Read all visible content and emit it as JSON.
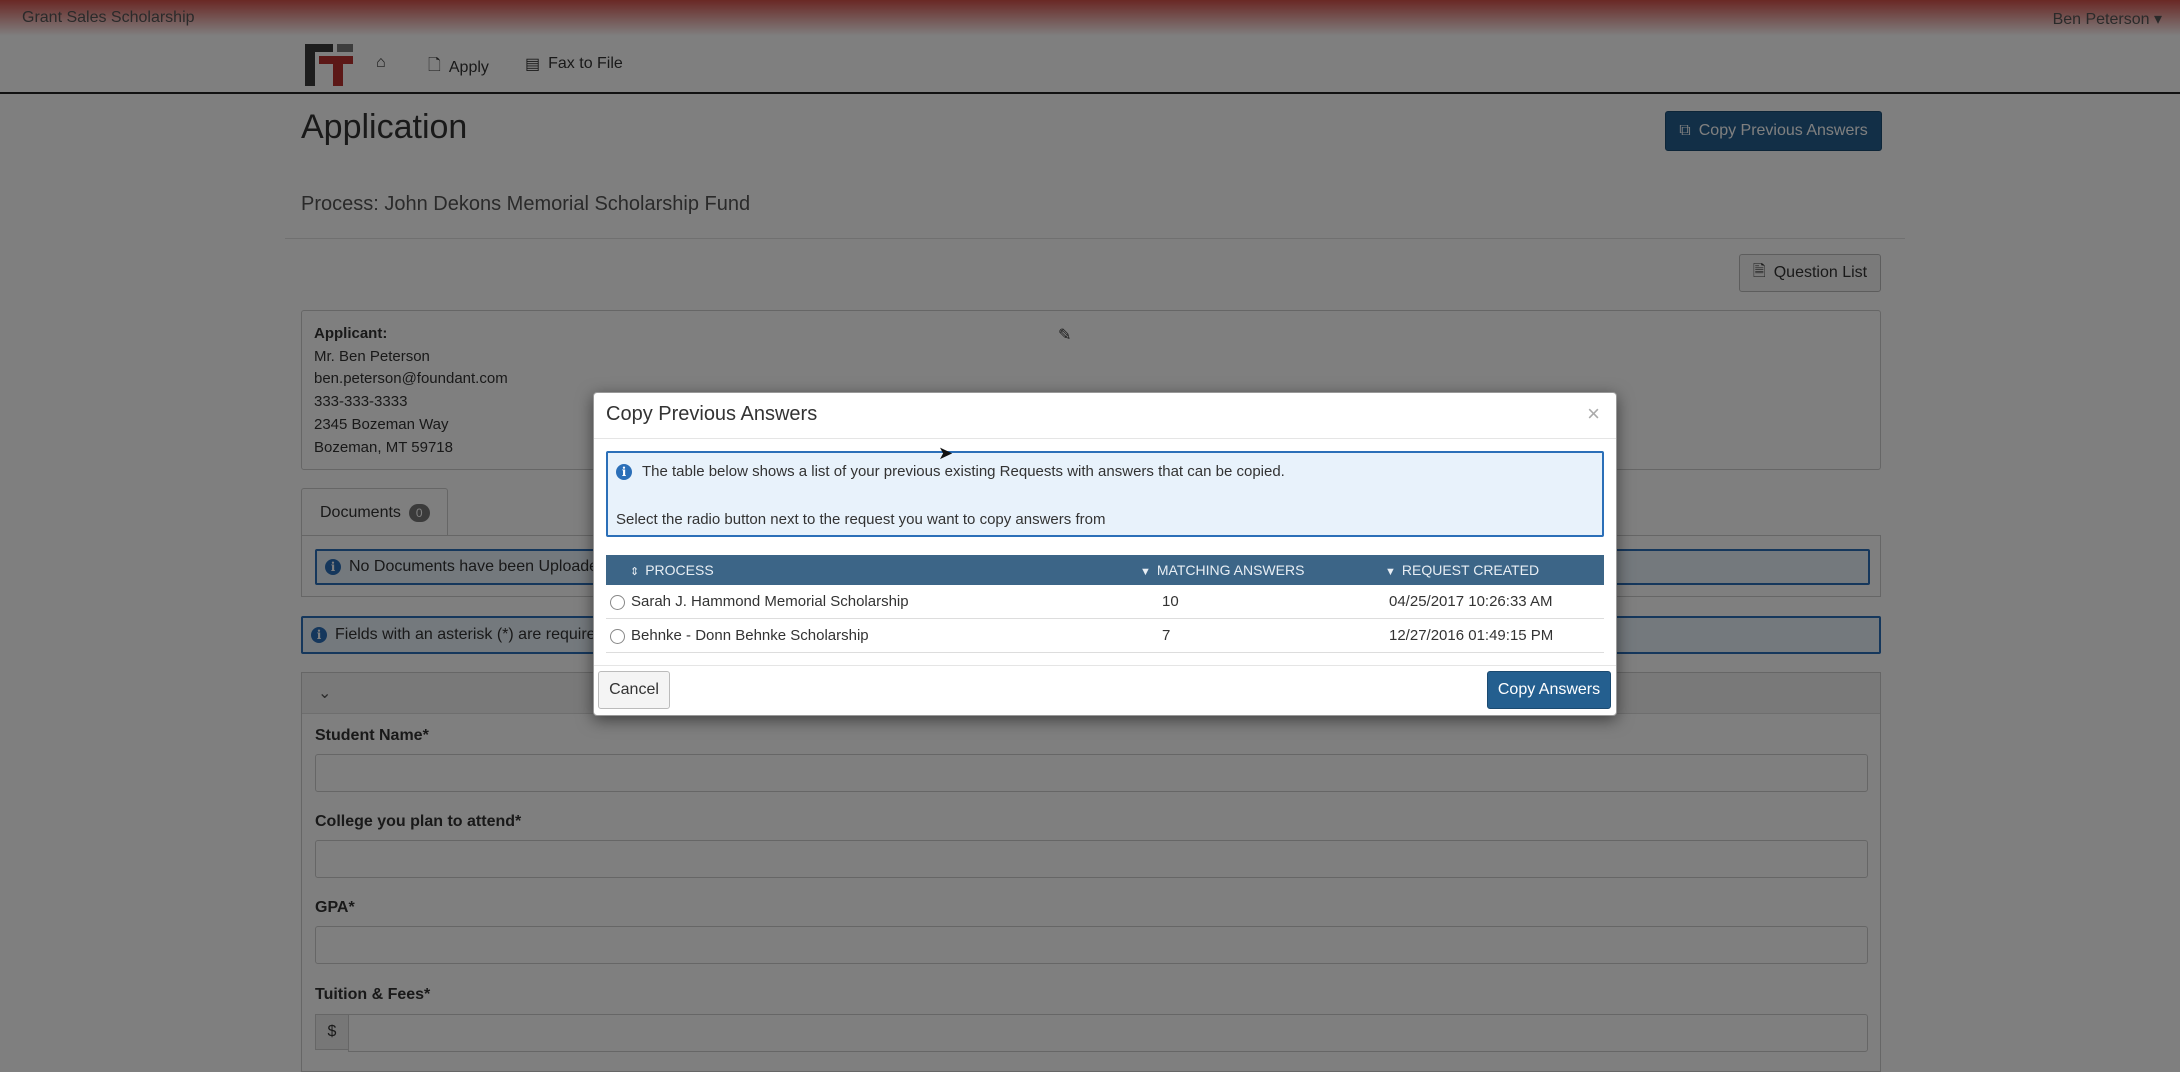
{
  "topbar": {
    "brand": "Grant Sales Scholarship",
    "user": "Ben Peterson"
  },
  "nav": {
    "apply": "Apply",
    "fax": "Fax to File"
  },
  "page": {
    "title": "Application",
    "copy_prev_label": "Copy Previous Answers",
    "process": "Process: John Dekons Memorial Scholarship Fund",
    "question_list_label": "Question List"
  },
  "applicant": {
    "label": "Applicant:",
    "name": "Mr. Ben Peterson",
    "email": "ben.peterson@foundant.com",
    "phone": "333-333-3333",
    "street": "2345 Bozeman Way",
    "city": "Bozeman, MT 59718"
  },
  "documents": {
    "tab_label": "Documents",
    "count": "0",
    "notice": "No Documents have been Uploade"
  },
  "fields_notice": "Fields with an asterisk (*) are require",
  "form": {
    "student_name": "Student Name*",
    "college": "College you plan to attend*",
    "gpa": "GPA*",
    "tuition": "Tuition & Fees*",
    "currency": "$"
  },
  "modal": {
    "title": "Copy Previous Answers",
    "close": "×",
    "info_line1": "The table below shows a list of your previous existing Requests with answers that can be copied.",
    "info_line2": "Select the radio button next to the request you want to copy answers from",
    "columns": {
      "process": "PROCESS",
      "matching": "MATCHING ANSWERS",
      "created": "REQUEST CREATED"
    },
    "rows": [
      {
        "process": "Sarah J. Hammond Memorial Scholarship",
        "matching": "10",
        "created": "04/25/2017 10:26:33 AM"
      },
      {
        "process": "Behnke - Donn Behnke Scholarship",
        "matching": "7",
        "created": "12/27/2016 01:49:15 PM"
      }
    ],
    "cancel": "Cancel",
    "copy": "Copy Answers"
  }
}
